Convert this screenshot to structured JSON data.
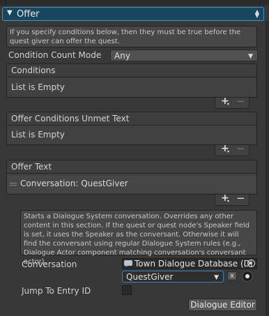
{
  "foldout": {
    "arrow": "▼",
    "title": "Offer",
    "updown_icon": "⬍"
  },
  "help_top": "If you specify conditions below, then they must be true before the quest giver can offer the quest.",
  "condition_count_mode": {
    "label": "Condition Count Mode",
    "value": "Any"
  },
  "conditions": {
    "header": "Conditions",
    "empty": "List is Empty"
  },
  "offer_conditions_unmet": {
    "header": "Offer Conditions Unmet Text",
    "empty": "List is Empty"
  },
  "offer_text": {
    "header": "Offer Text",
    "item": "Conversation: QuestGiver"
  },
  "list_buttons": {
    "plus": "+",
    "minus": "−",
    "chevron": "▾"
  },
  "help_conversation": "Starts a Dialogue System conversation. Overrides any other content in this section. If the quest or quest node's Speaker field is set, it uses the Speaker as the conversant. Otherwise it will find the conversant using regular Dialogue System rules (e.g., Dialogue Actor component matching conversation's conversant actor).",
  "conversation": {
    "label": "Conversation",
    "database": "Town Dialogue Database (Di",
    "selected": "QuestGiver",
    "clear": "x"
  },
  "jump_to_entry": {
    "label": "Jump To Entry ID"
  },
  "dialogue_editor_button": "Dialogue Editor"
}
